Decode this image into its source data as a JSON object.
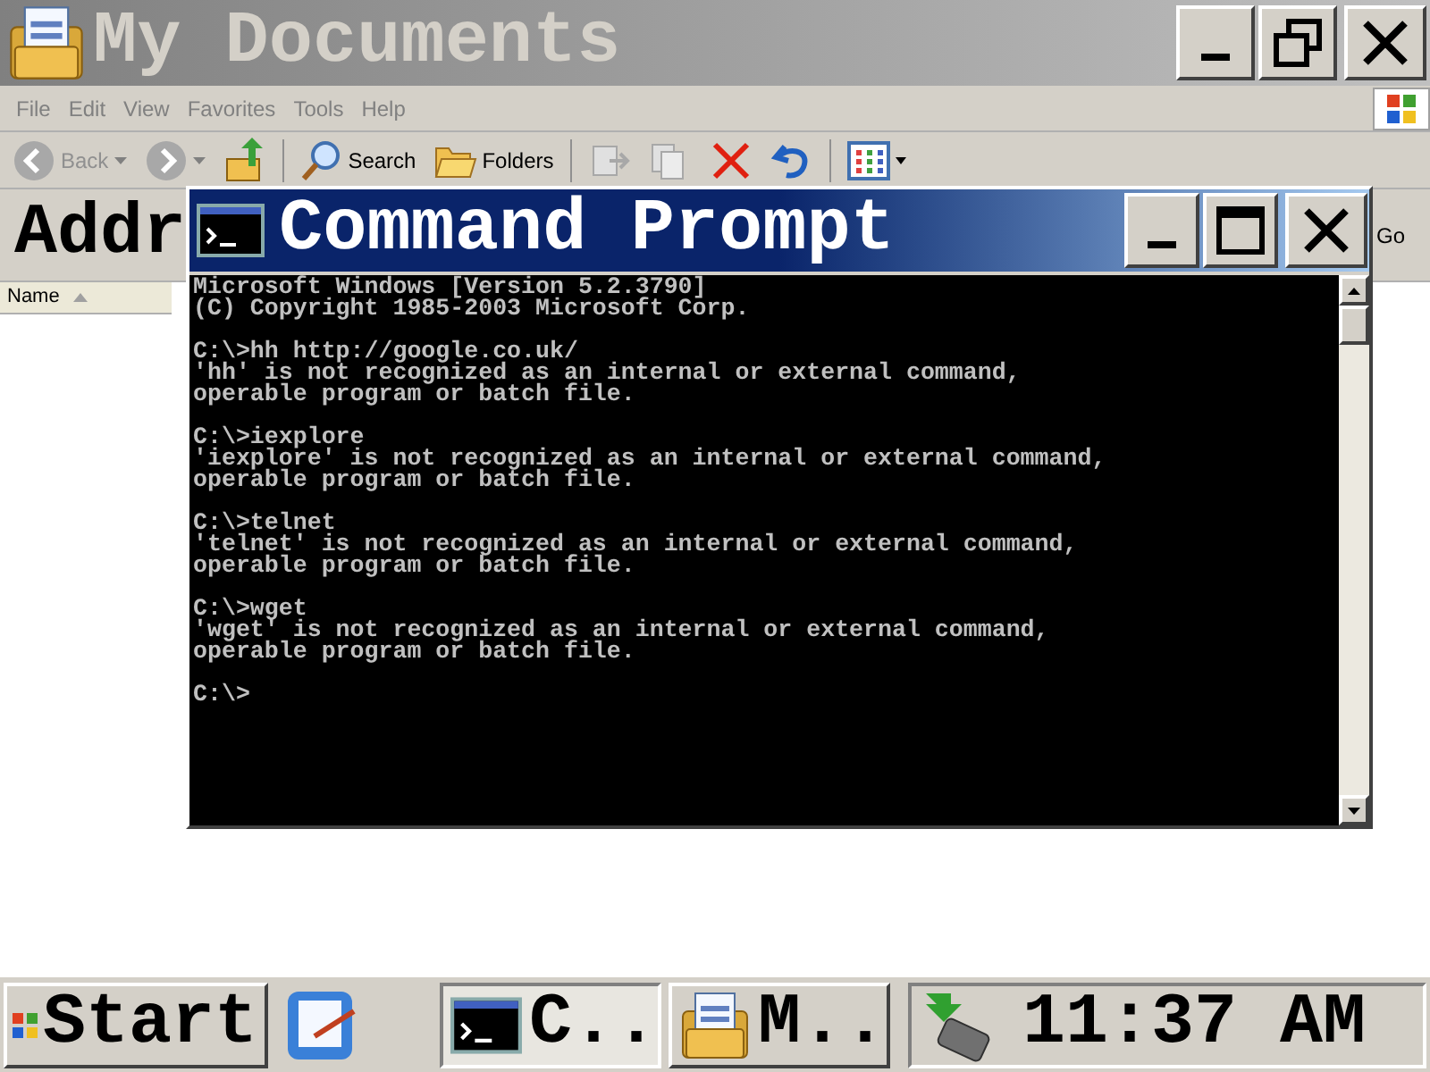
{
  "explorer": {
    "title": "My Documents",
    "menu": [
      "File",
      "Edit",
      "View",
      "Favorites",
      "Tools",
      "Help"
    ],
    "toolbar": [
      {
        "kind": "back",
        "label": "Back",
        "disabled": true
      },
      {
        "kind": "forward",
        "disabled": true
      },
      {
        "kind": "up",
        "disabled": false
      },
      {
        "kind": "search",
        "label": "Search",
        "disabled": false
      },
      {
        "kind": "folders",
        "label": "Folders",
        "disabled": false
      },
      {
        "kind": "move",
        "disabled": true
      },
      {
        "kind": "copy",
        "disabled": true
      },
      {
        "kind": "delete",
        "disabled": false
      },
      {
        "kind": "undo",
        "disabled": false
      },
      {
        "kind": "views",
        "disabled": false
      }
    ],
    "address_label": "Addr",
    "go": "Go",
    "column": "Name"
  },
  "console": {
    "title": "Command Prompt",
    "blocks": [
      [
        "Microsoft Windows [Version 5.2.3790]",
        "(C) Copyright 1985-2003 Microsoft Corp."
      ],
      [
        "C:\\>hh http://google.co.uk/",
        "'hh' is not recognized as an internal or external command,",
        "operable program or batch file."
      ],
      [
        "C:\\>iexplore",
        "'iexplore' is not recognized as an internal or external command,",
        "operable program or batch file."
      ],
      [
        "C:\\>telnet",
        "'telnet' is not recognized as an internal or external command,",
        "operable program or batch file."
      ],
      [
        "C:\\>wget",
        "'wget' is not recognized as an internal or external command,",
        "operable program or batch file."
      ],
      [
        "C:\\>"
      ]
    ]
  },
  "taskbar": {
    "start": "Start",
    "tasks": [
      {
        "kind": "console",
        "label": "C..",
        "selected": true
      },
      {
        "kind": "folder",
        "label": "M..",
        "selected": false
      }
    ],
    "clock": "11:37 AM"
  }
}
